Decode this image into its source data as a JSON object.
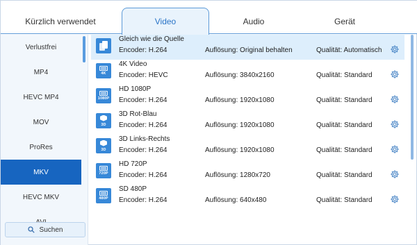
{
  "tabs": [
    {
      "label": "Kürzlich verwendet"
    },
    {
      "label": "Video"
    },
    {
      "label": "Audio"
    },
    {
      "label": "Gerät"
    }
  ],
  "sidebar": {
    "items": [
      {
        "label": "Verlustfrei"
      },
      {
        "label": "MP4"
      },
      {
        "label": "HEVC MP4"
      },
      {
        "label": "MOV"
      },
      {
        "label": "ProRes"
      },
      {
        "label": "MKV"
      },
      {
        "label": "HEVC MKV"
      },
      {
        "label": "AVI"
      }
    ],
    "selected": "MKV",
    "search_label": "Suchen"
  },
  "formats": [
    {
      "title": "Gleich wie die Quelle",
      "encoder": "Encoder: H.264",
      "resolution": "Auflösung: Original behalten",
      "quality": "Qualität: Automatisch",
      "icon": "same-as-source-icon",
      "tag": ""
    },
    {
      "title": "4K Video",
      "encoder": "Encoder: HEVC",
      "resolution": "Auflösung: 3840x2160",
      "quality": "Qualität: Standard",
      "icon": "4k-icon",
      "tag": "4K"
    },
    {
      "title": "HD 1080P",
      "encoder": "Encoder: H.264",
      "resolution": "Auflösung: 1920x1080",
      "quality": "Qualität: Standard",
      "icon": "1080p-icon",
      "tag": "1080P"
    },
    {
      "title": "3D Rot-Blau",
      "encoder": "Encoder: H.264",
      "resolution": "Auflösung: 1920x1080",
      "quality": "Qualität: Standard",
      "icon": "3d-icon",
      "tag": "3D"
    },
    {
      "title": "3D Links-Rechts",
      "encoder": "Encoder: H.264",
      "resolution": "Auflösung: 1920x1080",
      "quality": "Qualität: Standard",
      "icon": "3d-icon",
      "tag": "3D"
    },
    {
      "title": "HD 720P",
      "encoder": "Encoder: H.264",
      "resolution": "Auflösung: 1280x720",
      "quality": "Qualität: Standard",
      "icon": "720p-icon",
      "tag": "720P"
    },
    {
      "title": "SD 480P",
      "encoder": "Encoder: H.264",
      "resolution": "Auflösung: 640x480",
      "quality": "Qualität: Standard",
      "icon": "480p-icon",
      "tag": "480P"
    }
  ],
  "colors": {
    "accent": "#1765c0",
    "tab_border": "#5d9ad8",
    "icon_bg": "#3788d8",
    "selected_row": "#ddeefc"
  }
}
